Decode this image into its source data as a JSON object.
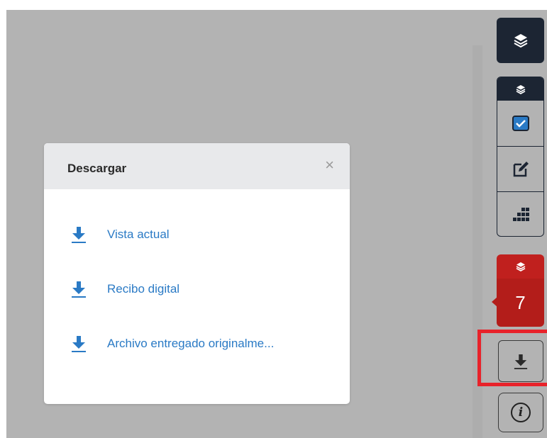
{
  "modal": {
    "title": "Descargar",
    "close_glyph": "×",
    "items": [
      {
        "label": "Vista actual",
        "icon": "download-icon"
      },
      {
        "label": "Recibo digital",
        "icon": "download-icon"
      },
      {
        "label": "Archivo entregado originalme...",
        "icon": "download-icon"
      }
    ]
  },
  "toolbar": {
    "layers_icon": "layers-icon",
    "tools": [
      "checkbox-icon",
      "edit-icon",
      "grid-icon"
    ],
    "red_group_count": "7",
    "download_icon": "download-icon",
    "info_glyph": "i"
  },
  "colors": {
    "backdrop": "#b3b3b3",
    "link": "#2a7ac5",
    "dark_toolbar": "#1c2533",
    "red_group": "#b31d1a",
    "highlight": "#e8222a"
  }
}
